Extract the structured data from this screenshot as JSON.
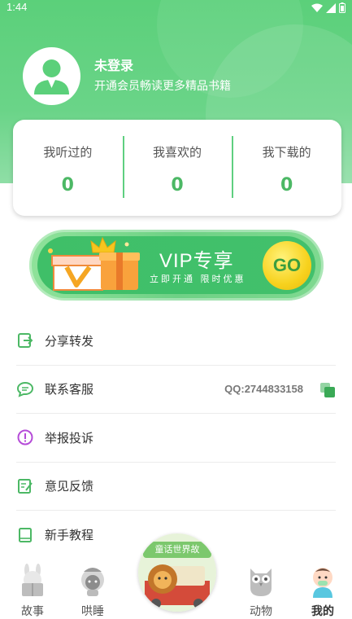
{
  "status_bar": {
    "time": "1:44"
  },
  "profile": {
    "name": "未登录",
    "subtitle": "开通会员畅读更多精品书籍"
  },
  "stats": [
    {
      "label": "我听过的",
      "value": "0"
    },
    {
      "label": "我喜欢的",
      "value": "0"
    },
    {
      "label": "我下载的",
      "value": "0"
    }
  ],
  "vip_banner": {
    "title": "VIP专享",
    "subtitle": "立即开通 限时优惠",
    "go_label": "GO"
  },
  "menu": [
    {
      "label": "分享转发",
      "icon": "share-icon"
    },
    {
      "label": "联系客服",
      "icon": "chat-icon",
      "extra": "QQ:2744833158"
    },
    {
      "label": "举报投诉",
      "icon": "alert-icon"
    },
    {
      "label": "意见反馈",
      "icon": "feedback-icon"
    },
    {
      "label": "新手教程",
      "icon": "book-icon"
    }
  ],
  "tabs": [
    {
      "label": "故事"
    },
    {
      "label": "哄睡"
    },
    {
      "label": "动物"
    },
    {
      "label": "我的"
    }
  ],
  "center_tab": {
    "banner_text": "童话世界故"
  },
  "colors": {
    "primary": "#5bd07a",
    "accent": "#4cb865",
    "gold": "#f7d21e"
  }
}
